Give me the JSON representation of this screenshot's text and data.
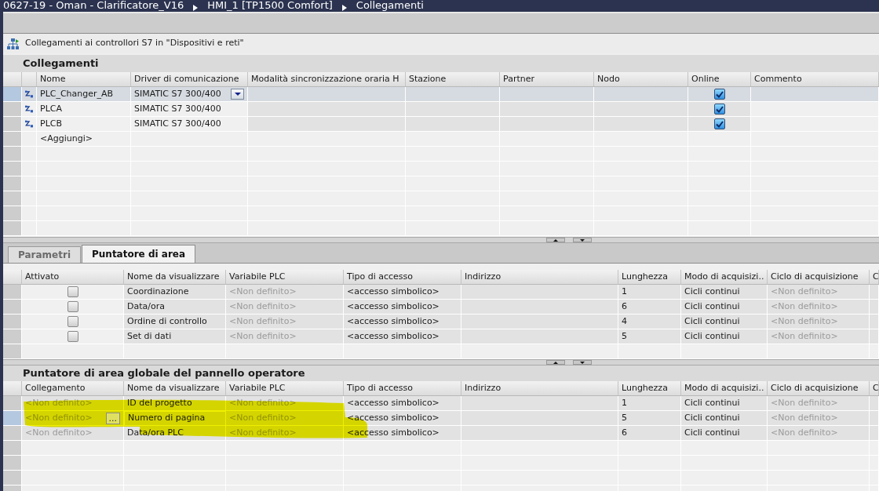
{
  "breadcrumb": [
    "0627-19 - Oman - Clarificatore_V16",
    "HMI_1 [TP1500 Comfort]",
    "Collegamenti"
  ],
  "info_bar": {
    "text": "Collegamenti ai controllori S7 in \"Dispositivi e reti\""
  },
  "connections": {
    "title": "Collegamenti",
    "columns": [
      "Nome",
      "Driver di comunicazione",
      "Modalità  sincronizzazione  oraria H",
      "Stazione",
      "Partner",
      "Nodo",
      "Online",
      "Commento"
    ],
    "rows": [
      {
        "name": "PLC_Changer_AB",
        "driver": "SIMATIC S7 300/400",
        "online": true,
        "selected": true
      },
      {
        "name": "PLCA",
        "driver": "SIMATIC S7 300/400",
        "online": true,
        "selected": false
      },
      {
        "name": "PLCB",
        "driver": "SIMATIC S7 300/400",
        "online": true,
        "selected": false
      }
    ],
    "add_row": "<Aggiungi>"
  },
  "tabs": [
    {
      "label": "Parametri",
      "selected": false
    },
    {
      "label": "Puntatore di area",
      "selected": true
    }
  ],
  "area_pointers": {
    "columns": [
      "Attivato",
      "Nome da visualizzare",
      "Variabile PLC",
      "Tipo di accesso",
      "Indirizzo",
      "Lunghezza",
      "Modo di acquisizi..",
      "Ciclo di acquisizione",
      "C"
    ],
    "rows": [
      {
        "activated": false,
        "name": "Coordinazione",
        "plc_variable": "<Non definito>",
        "access_type": "<accesso simbolico>",
        "length": "1",
        "mode": "Cicli continui",
        "cycle": "<Non definito>"
      },
      {
        "activated": false,
        "name": "Data/ora",
        "plc_variable": "<Non definito>",
        "access_type": "<accesso simbolico>",
        "length": "6",
        "mode": "Cicli continui",
        "cycle": "<Non definito>"
      },
      {
        "activated": false,
        "name": "Ordine di controllo",
        "plc_variable": "<Non definito>",
        "access_type": "<accesso simbolico>",
        "length": "4",
        "mode": "Cicli continui",
        "cycle": "<Non definito>"
      },
      {
        "activated": false,
        "name": "Set di dati",
        "plc_variable": "<Non definito>",
        "access_type": "<accesso simbolico>",
        "length": "5",
        "mode": "Cicli continui",
        "cycle": "<Non definito>"
      }
    ]
  },
  "global_pointers": {
    "title": "Puntatore di area globale del pannello operatore",
    "columns": [
      "Collegamento",
      "Nome da visualizzare",
      "Variabile PLC",
      "Tipo di accesso",
      "Indirizzo",
      "Lunghezza",
      "Modo di acquisizi..",
      "Ciclo di acquisizione",
      "C"
    ],
    "browse_button": "...",
    "rows": [
      {
        "connection": "<Non definito>",
        "name": "ID del progetto",
        "plc_variable": "<Non definito>",
        "access_type": "<accesso simbolico>",
        "length": "1",
        "mode": "Cicli continui",
        "cycle": "<Non definito>",
        "selected": false
      },
      {
        "connection": "<Non definito>",
        "name": "Numero di pagina",
        "plc_variable": "<Non definito>",
        "access_type": "<accesso simbolico>",
        "length": "5",
        "mode": "Cicli continui",
        "cycle": "<Non definito>",
        "selected": true
      },
      {
        "connection": "<Non definito>",
        "name": "Data/ora PLC",
        "plc_variable": "<Non definito>",
        "access_type": "<accesso simbolico>",
        "length": "6",
        "mode": "Cicli continui",
        "cycle": "<Non definito>",
        "selected": false
      }
    ]
  }
}
